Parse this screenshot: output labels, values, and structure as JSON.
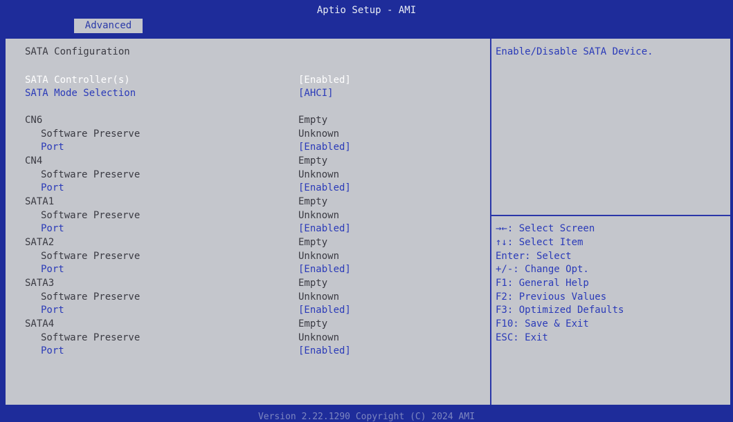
{
  "header": {
    "title": "Aptio Setup - AMI",
    "active_tab": "Advanced"
  },
  "page": {
    "heading": "SATA Configuration",
    "controller": {
      "label": "SATA Controller(s)",
      "value": "[Enabled]"
    },
    "mode": {
      "label": "SATA Mode Selection",
      "value": "[AHCI]"
    },
    "ports": [
      {
        "name": "CN6",
        "status": "Empty",
        "sp_label": "Software Preserve",
        "sp_value": "Unknown",
        "port_label": "Port",
        "port_value": "[Enabled]"
      },
      {
        "name": "CN4",
        "status": "Empty",
        "sp_label": "Software Preserve",
        "sp_value": "Unknown",
        "port_label": "Port",
        "port_value": "[Enabled]"
      },
      {
        "name": "SATA1",
        "status": "Empty",
        "sp_label": "Software Preserve",
        "sp_value": "Unknown",
        "port_label": "Port",
        "port_value": "[Enabled]"
      },
      {
        "name": "SATA2",
        "status": "Empty",
        "sp_label": "Software Preserve",
        "sp_value": "Unknown",
        "port_label": "Port",
        "port_value": "[Enabled]"
      },
      {
        "name": "SATA3",
        "status": "Empty",
        "sp_label": "Software Preserve",
        "sp_value": "Unknown",
        "port_label": "Port",
        "port_value": "[Enabled]"
      },
      {
        "name": "SATA4",
        "status": "Empty",
        "sp_label": "Software Preserve",
        "sp_value": "Unknown",
        "port_label": "Port",
        "port_value": "[Enabled]"
      }
    ]
  },
  "help": {
    "description": "Enable/Disable SATA Device.",
    "keys": [
      "→←: Select Screen",
      "↑↓: Select Item",
      "Enter: Select",
      "+/-: Change Opt.",
      "F1: General Help",
      "F2: Previous Values",
      "F3: Optimized Defaults",
      "F10: Save & Exit",
      "ESC: Exit"
    ]
  },
  "footer": {
    "version": "Version 2.22.1290 Copyright (C) 2024 AMI"
  },
  "colors": {
    "background": "#1e2c9a",
    "panel": "#c4c6cc",
    "highlight": "#ffffff",
    "selectable": "#2a3ab8",
    "static_text": "#3a3a42"
  }
}
